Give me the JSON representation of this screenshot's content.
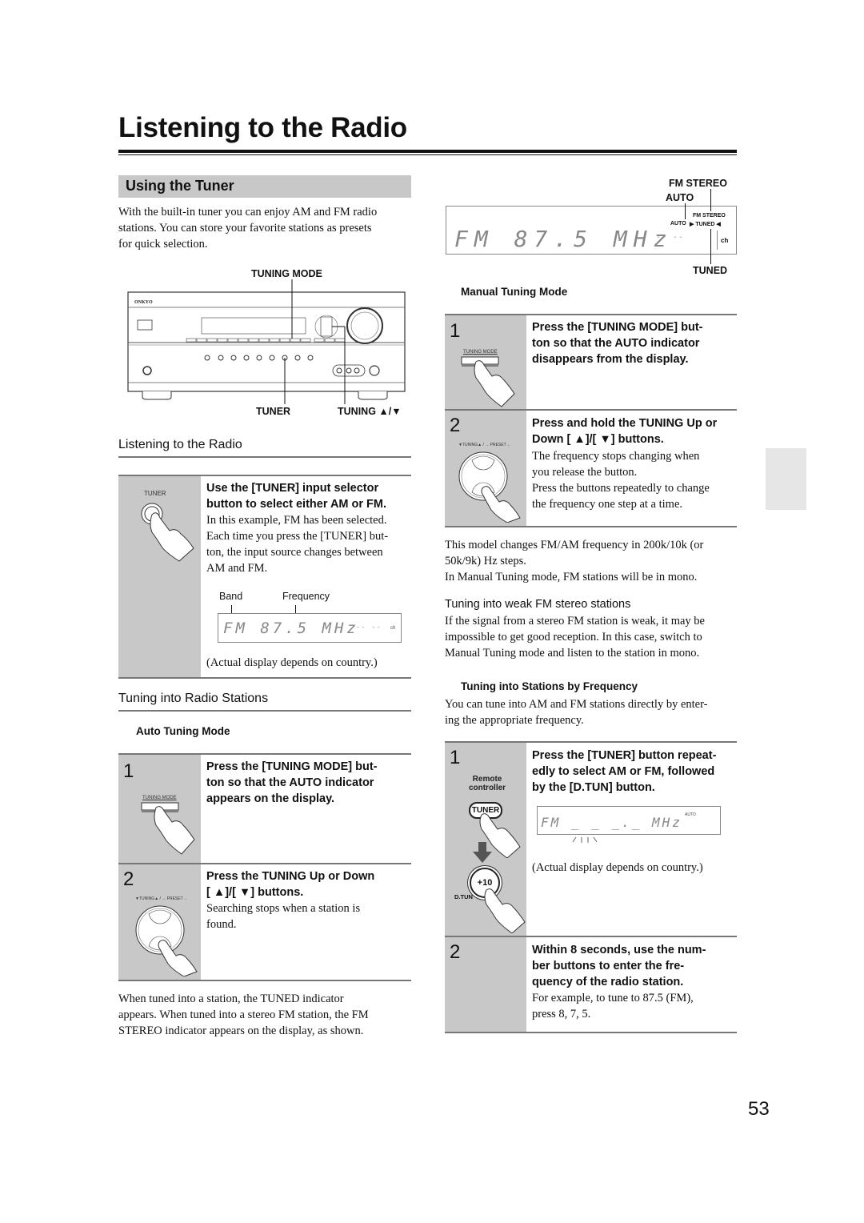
{
  "page": {
    "title": "Listening to the Radio",
    "number": "53"
  },
  "left": {
    "section_title": "Using the Tuner",
    "intro_lines": [
      "With the built-in tuner you can enjoy AM and FM radio",
      "stations. You can store your favorite stations as presets",
      "for quick selection."
    ],
    "receiver_figure": {
      "brand": "ONKYO",
      "callout_tuning_mode": "TUNING MODE",
      "callout_tuner": "TUNER",
      "callout_tuning": "TUNING ▲/▼"
    },
    "listening_subhead": "Listening to the Radio",
    "tuner_step": {
      "icon_label": "TUNER",
      "title_lines": [
        "Use the [TUNER] input selector",
        "button to select either AM or FM."
      ],
      "body_lines": [
        "In this example, FM has been selected.",
        "Each time you press the [TUNER] but-",
        "ton, the input source changes between",
        "AM and FM."
      ],
      "band_label": "Band",
      "frequency_label": "Frequency",
      "display_text": "FM 87.5 MHz",
      "display_suffix": "-- --",
      "display_ch": "ch",
      "caption": "(Actual display depends on country.)"
    },
    "tuning_subhead": "Tuning into Radio Stations",
    "auto_mode_heading": "Auto Tuning Mode",
    "auto_steps": [
      {
        "number": "1",
        "icon_label": "TUNING MODE",
        "title_lines": [
          "Press the [TUNING MODE] but-",
          "ton so that the AUTO indicator",
          "appears on the display."
        ],
        "body_lines": []
      },
      {
        "number": "2",
        "icon_label": "▼TUNING▲ / → PRESET ←",
        "title_lines": [
          "Press the TUNING Up or Down",
          "[ ▲]/[ ▼] buttons."
        ],
        "body_lines": [
          "Searching stops when a station is",
          "found."
        ]
      }
    ],
    "closing_lines": [
      "When tuned into a station, the TUNED indicator",
      "appears. When tuned into a stereo FM station, the FM",
      "STEREO indicator appears on the display, as shown."
    ]
  },
  "right": {
    "display_figure": {
      "callout_fm_stereo": "FM STEREO",
      "callout_auto": "AUTO",
      "callout_tuned": "TUNED",
      "ind_fm_stereo": "FM STEREO",
      "ind_auto": "AUTO",
      "ind_tuned": "▶ TUNED ◀",
      "display_text": "FM 87.5 MHz",
      "display_suffix": "-- --",
      "display_ch": "ch"
    },
    "manual_mode_heading": "Manual Tuning Mode",
    "manual_steps": [
      {
        "number": "1",
        "icon_label": "TUNING MODE",
        "title_lines": [
          "Press the [TUNING MODE] but-",
          "ton so that the AUTO indicator",
          "disappears from the display."
        ],
        "body_lines": []
      },
      {
        "number": "2",
        "icon_label": "▼TUNING▲ / → PRESET ←",
        "title_lines": [
          "Press and hold the TUNING Up or",
          "Down [ ▲]/[ ▼] buttons."
        ],
        "body_lines": [
          "The frequency stops changing when",
          "you release the button.",
          "Press the buttons repeatedly to change",
          "the frequency one step at a time."
        ]
      }
    ],
    "manual_notes": [
      "This model changes FM/AM frequency in 200k/10k (or",
      "50k/9k) Hz steps.",
      "In Manual Tuning mode, FM stations will be in mono."
    ],
    "weak_heading": "Tuning into weak FM stereo stations",
    "weak_lines": [
      "If the signal from a stereo FM station is weak, it may be",
      "impossible to get good reception. In this case, switch to",
      "Manual Tuning mode and listen to the station in mono."
    ],
    "freq_heading": "Tuning into Stations by Frequency",
    "freq_lines": [
      "You can tune into AM and FM stations directly by enter-",
      "ing the appropriate frequency."
    ],
    "freq_steps": [
      {
        "number": "1",
        "remote_label_1": "Remote",
        "remote_label_2": "controller",
        "tuner_button": "TUNER",
        "dtun_button": "+10",
        "dtun_label": "D.TUN",
        "title_lines": [
          "Press the [TUNER] button repeat-",
          "edly to select AM or FM, followed",
          "by the [D.TUN] button."
        ],
        "display_text": "FM _ _ _._ MHz",
        "display_auto": "AUTO",
        "caption": "(Actual display depends on country.)"
      },
      {
        "number": "2",
        "title_lines": [
          "Within 8 seconds, use the num-",
          "ber buttons to enter the fre-",
          "quency of the radio station."
        ],
        "body_lines": [
          "For example, to tune to 87.5 (FM),",
          "press 8, 7, 5."
        ]
      }
    ]
  }
}
